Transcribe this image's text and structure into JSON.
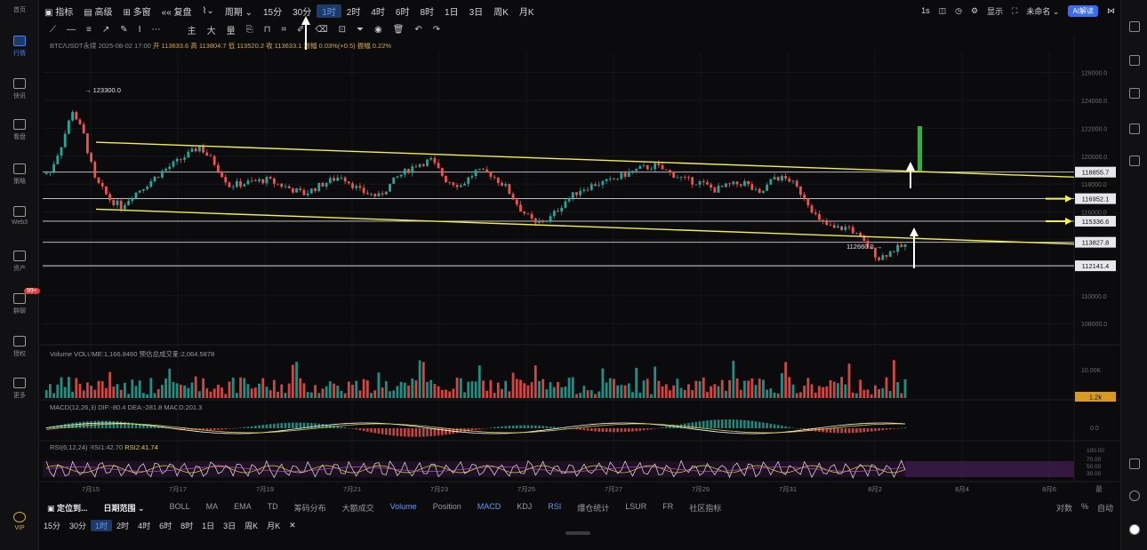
{
  "sidebar": {
    "items": [
      {
        "label": "首页",
        "icon": "home-icon"
      },
      {
        "label": "行情",
        "icon": "chart-icon",
        "active": true
      },
      {
        "label": "快讯",
        "icon": "news-icon"
      },
      {
        "label": "看盘",
        "icon": "monitor-icon"
      },
      {
        "label": "策略",
        "icon": "robot-icon"
      },
      {
        "label": "Web3",
        "icon": "web3-icon"
      },
      {
        "label": "资产",
        "icon": "wallet-icon"
      },
      {
        "label": "群聊",
        "icon": "chat-icon",
        "badge": "99+"
      },
      {
        "label": "授权",
        "icon": "key-icon"
      },
      {
        "label": "更多",
        "icon": "grid-icon"
      }
    ],
    "vip": "VIP"
  },
  "toolbar": {
    "indicators": "指标",
    "advanced": "高级",
    "multi": "多窗",
    "replay": "复盘",
    "period": "周期",
    "intervals": [
      "15分",
      "30分",
      "1时",
      "2时",
      "4时",
      "6时",
      "8时",
      "1日",
      "3日",
      "周K",
      "月K"
    ],
    "active_interval": "1时",
    "right_items": [
      "1s",
      "显示",
      "未命名"
    ],
    "ai_label": "AI解读"
  },
  "drawbar": {
    "items": [
      "主",
      "大",
      "量"
    ]
  },
  "legend": {
    "symbol": "BTC/USDT永续 2025-08-02 17:00",
    "values": "开 113633.6 高 113804.7 低 113520.2 收 113633.1 涨幅 0.03%(+0.5) 振幅 0.22%"
  },
  "volume_legend": {
    "text": "Volume VOLUME:1,166.8460",
    "ma": "预估总成交量:2,064.5878"
  },
  "macd_legend": {
    "text": "MACD(12,26,9)",
    "values": "DIF:-80.4 DEA:-281.8 MACD:201.3"
  },
  "rsi_legend": {
    "text": "RSI(6,12,24)",
    "rsi1": "RSI1:42.70",
    "rsi2": "RSI2:41.74"
  },
  "indbar": {
    "left": [
      "定位到...",
      "日期范围"
    ],
    "items": [
      "BOLL",
      "MA",
      "EMA",
      "TD",
      "筹码分布",
      "大额成交",
      "Volume",
      "Position",
      "MACD",
      "KDJ",
      "RSI",
      "爆仓统计",
      "LSUR",
      "FR",
      "社区指标"
    ],
    "blue": [
      "Volume",
      "MACD",
      "RSI"
    ],
    "right": [
      "对数",
      "%",
      "自动"
    ]
  },
  "periodbar": {
    "items": [
      "15分",
      "30分",
      "1时",
      "2时",
      "4时",
      "6时",
      "8时",
      "1日",
      "3日",
      "周K",
      "月K",
      "✕"
    ],
    "active": "1时"
  },
  "chart_data": {
    "type": "candlestick",
    "symbol": "BTC/USDT",
    "y_ticks": [
      126000.0,
      124000.0,
      122000.0,
      120000.0,
      118000.0,
      116000.0,
      114000.0,
      112000.0,
      110000.0,
      108000.0
    ],
    "ylim": [
      107500,
      127500
    ],
    "x_ticks": [
      "7月15",
      "7月17",
      "7月19",
      "7月21",
      "7月23",
      "7月25",
      "7月27",
      "7月29",
      "7月31",
      "8月2",
      "8月4",
      "8月6"
    ],
    "x_tick_right": "最",
    "high_label": "123300.0",
    "low_label": "112660.0",
    "horizontal_levels": [
      {
        "value": 118855.7,
        "label": "118855.7"
      },
      {
        "value": 116952.1,
        "label": "116952.1"
      },
      {
        "value": 115336.6,
        "label": "115336.6"
      },
      {
        "value": 113827.8,
        "label": "113827.8"
      },
      {
        "value": 112141.4,
        "label": "112141.4"
      }
    ],
    "channel_upper": {
      "start": [
        "7月15",
        121000
      ],
      "end": [
        "8月6",
        118500
      ]
    },
    "channel_lower": {
      "start": [
        "7月15",
        116200
      ],
      "end": [
        "8月6",
        113700
      ]
    },
    "price_path": [
      [
        0,
        118700
      ],
      [
        2,
        118900
      ],
      [
        5,
        120800
      ],
      [
        8,
        123300
      ],
      [
        11,
        121500
      ],
      [
        14,
        118300
      ],
      [
        18,
        116900
      ],
      [
        21,
        116400
      ],
      [
        24,
        117200
      ],
      [
        28,
        118000
      ],
      [
        32,
        118900
      ],
      [
        36,
        119600
      ],
      [
        40,
        120300
      ],
      [
        42,
        120700
      ],
      [
        46,
        119500
      ],
      [
        50,
        117900
      ],
      [
        55,
        118100
      ],
      [
        60,
        118300
      ],
      [
        65,
        117800
      ],
      [
        70,
        117300
      ],
      [
        75,
        118000
      ],
      [
        80,
        118600
      ],
      [
        85,
        117500
      ],
      [
        90,
        117100
      ],
      [
        95,
        118500
      ],
      [
        100,
        119400
      ],
      [
        104,
        119700
      ],
      [
        108,
        118300
      ],
      [
        112,
        117900
      ],
      [
        116,
        118900
      ],
      [
        120,
        118700
      ],
      [
        124,
        117800
      ],
      [
        128,
        116200
      ],
      [
        132,
        115100
      ],
      [
        136,
        115600
      ],
      [
        140,
        116800
      ],
      [
        144,
        117600
      ],
      [
        148,
        118000
      ],
      [
        152,
        118200
      ],
      [
        156,
        118700
      ],
      [
        160,
        119100
      ],
      [
        164,
        119300
      ],
      [
        168,
        118800
      ],
      [
        172,
        118300
      ],
      [
        176,
        118100
      ],
      [
        180,
        117600
      ],
      [
        184,
        117900
      ],
      [
        188,
        118100
      ],
      [
        192,
        117200
      ],
      [
        196,
        118500
      ],
      [
        200,
        118300
      ],
      [
        204,
        117100
      ],
      [
        208,
        115300
      ],
      [
        212,
        114800
      ],
      [
        216,
        114900
      ],
      [
        220,
        113800
      ],
      [
        224,
        112700
      ],
      [
        228,
        113300
      ],
      [
        231,
        113600
      ]
    ],
    "annotations": [
      "green-target-bar",
      "arrow-up-1",
      "arrow-up-2",
      "arrow-up-3",
      "arrow-right-116952",
      "arrow-right-115336"
    ],
    "volume_right_label": "1.2k",
    "volume_scale_label": "10.00K",
    "macd_right_label": "0.0",
    "rsi_right_labels": [
      "100.00",
      "70.00",
      "50.00",
      "30.00"
    ]
  }
}
